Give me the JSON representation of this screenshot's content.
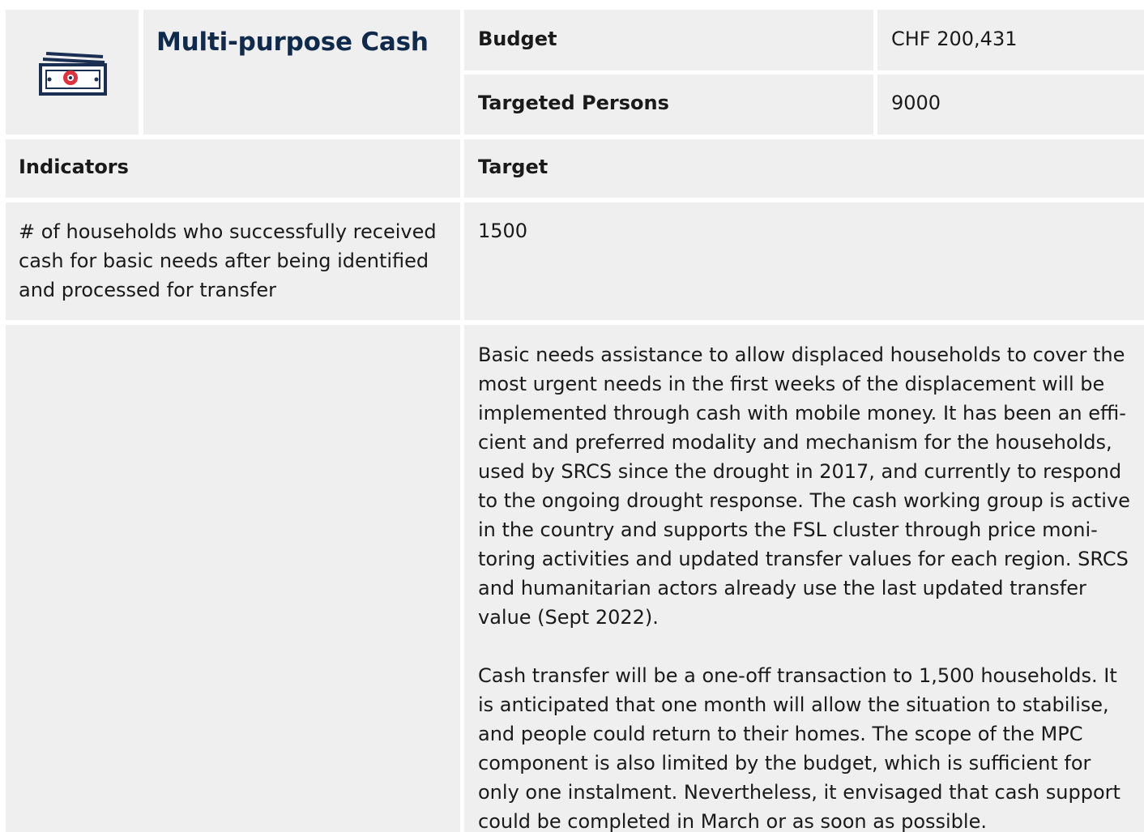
{
  "header": {
    "icon": "cash-money-icon",
    "title": "Multi-purpose Cash",
    "budget_label": "Budget",
    "budget_value": "CHF 200,431",
    "persons_label": "Targeted Persons",
    "persons_value": "9000"
  },
  "table": {
    "col_indicators": "Indicators",
    "col_target": "Target",
    "rows": [
      {
        "indicator": "# of households who successfully received cash for basic needs after being identified and processed for transfer",
        "target": "1500"
      }
    ]
  },
  "narrative": {
    "paragraphs": [
      "Basic needs assistance to allow displaced households to cover the most urgent needs in the first weeks of the displacement will be implemented through cash with mobile money. It has been an effi-cient and preferred modality and mechanism for the households, used by SRCS since the drought in 2017, and currently to respond to the ongoing drought response. The cash working group is active in the country and supports the FSL cluster through price moni-toring activities and updated transfer values for each region. SRCS and humanitarian actors already use the last updated transfer value (Sept 2022).",
      "Cash transfer will be a one-off transaction to 1,500 households. It is anticipated that one month will allow the situation to stabilise, and people could return to their homes. The scope of the MPC component is also limited by the budget, which is sufficient for only one instalment. Nevertheless, it envisaged that cash support could be completed in March or as soon as possible."
    ]
  },
  "colors": {
    "cell_bg": "#efeff0",
    "title": "#0f2a4a",
    "icon_navy": "#1b2f52",
    "icon_red": "#e0313c"
  }
}
